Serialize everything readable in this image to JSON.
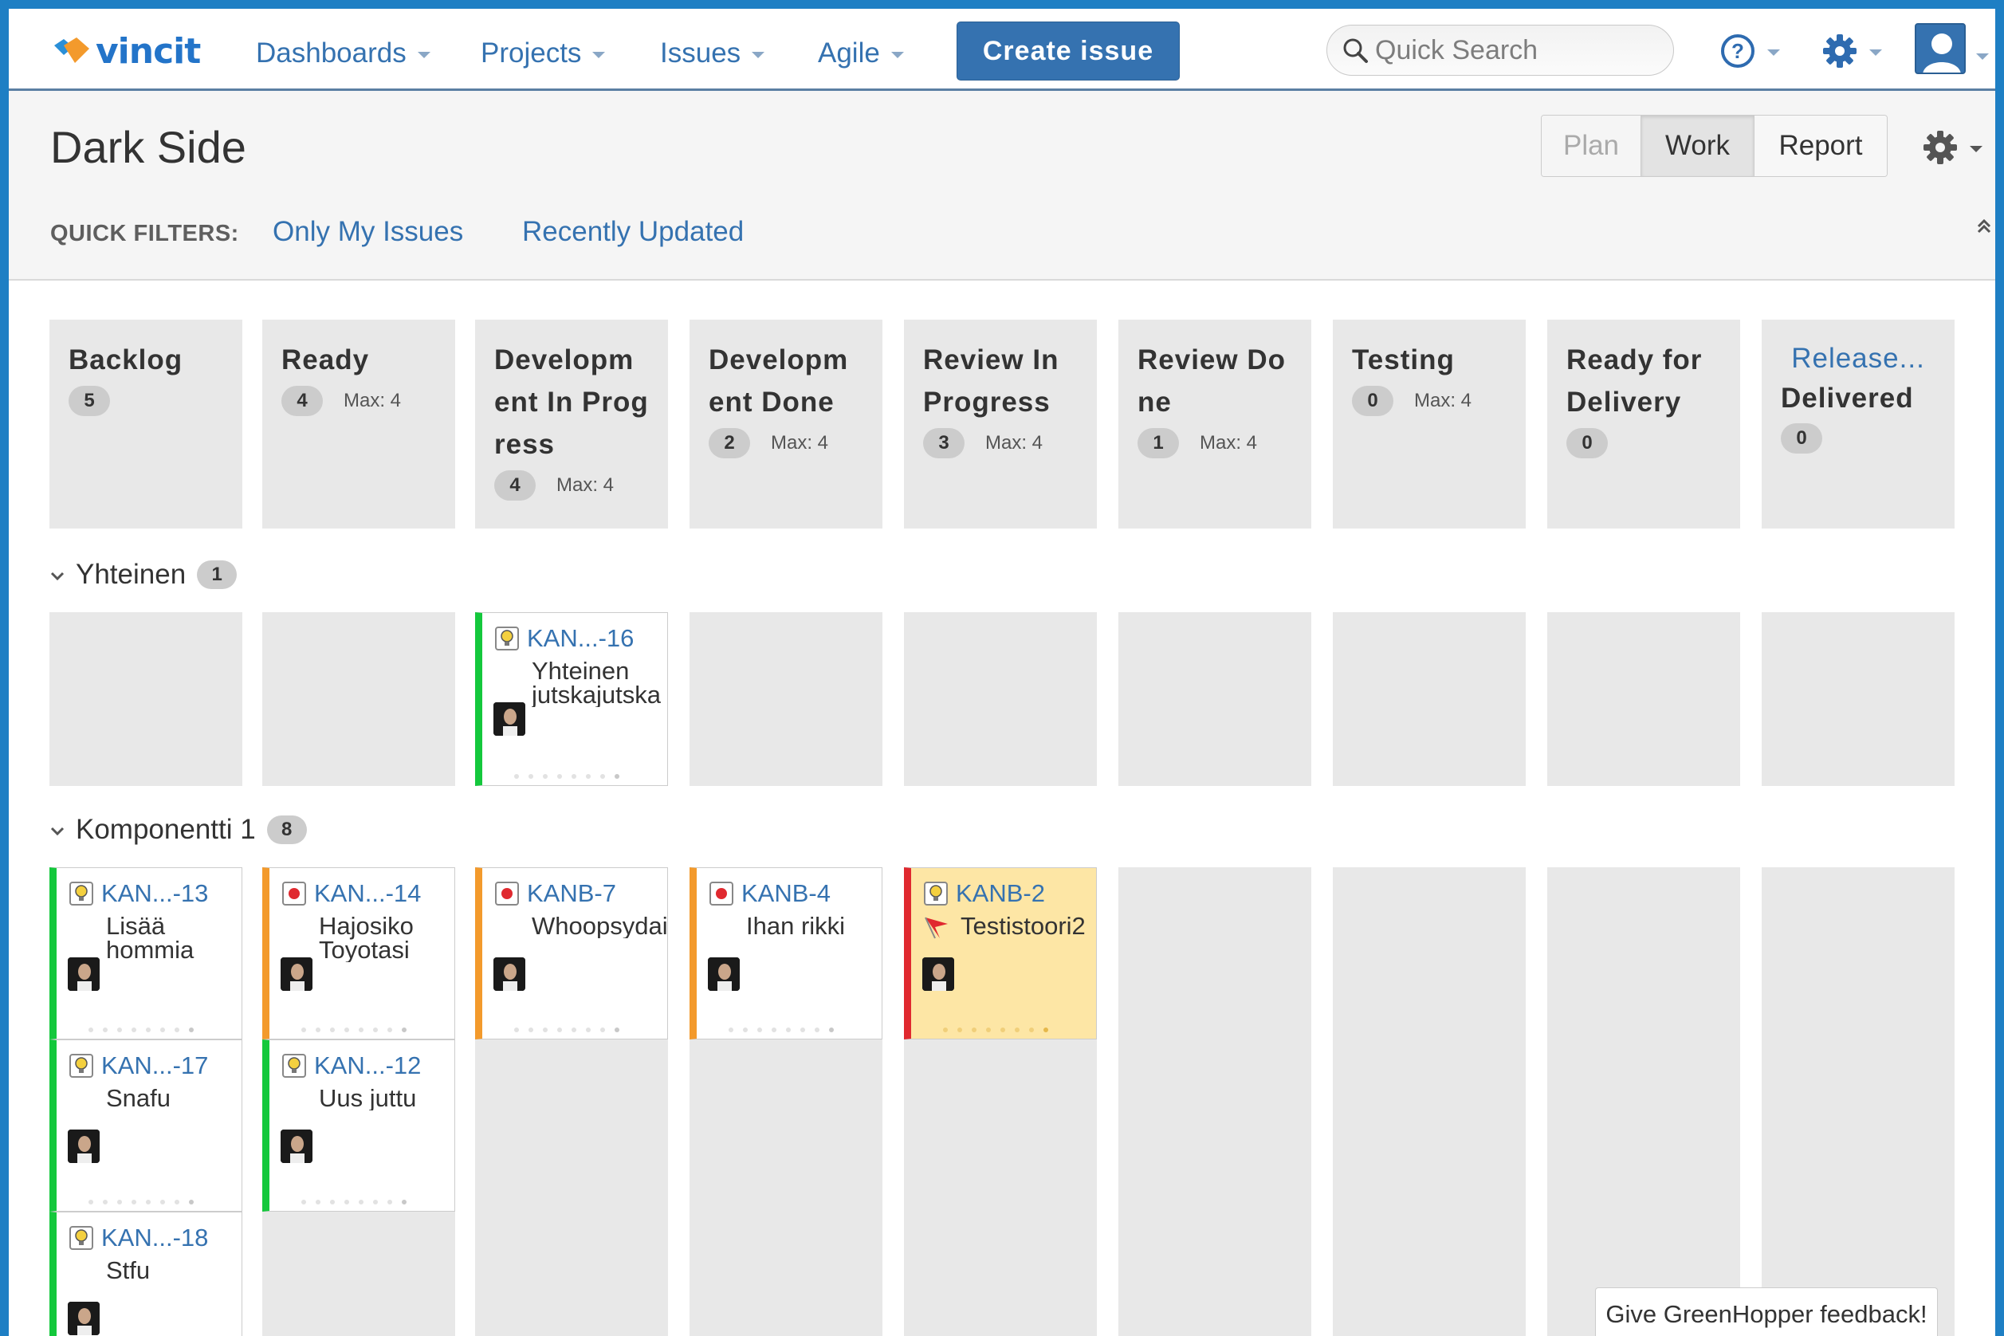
{
  "header": {
    "logo_text": "vincit",
    "nav": [
      {
        "label": "Dashboards"
      },
      {
        "label": "Projects"
      },
      {
        "label": "Issues"
      },
      {
        "label": "Agile"
      }
    ],
    "create_label": "Create issue",
    "search_placeholder": "Quick Search"
  },
  "board": {
    "title": "Dark Side",
    "modes": [
      {
        "label": "Plan",
        "state": "disabled"
      },
      {
        "label": "Work",
        "state": "active"
      },
      {
        "label": "Report",
        "state": "normal"
      }
    ],
    "quick_filters_label": "QUICK FILTERS:",
    "quick_filters": [
      "Only My Issues",
      "Recently Updated"
    ]
  },
  "columns": [
    {
      "name": "Backlog",
      "count": "5",
      "max": ""
    },
    {
      "name": "Ready",
      "count": "4",
      "max": "Max: 4"
    },
    {
      "name": "Development In Progress",
      "count": "4",
      "max": "Max: 4"
    },
    {
      "name": "Development Done",
      "count": "2",
      "max": "Max: 4"
    },
    {
      "name": "Review In Progress",
      "count": "3",
      "max": "Max: 4"
    },
    {
      "name": "Review Done",
      "count": "1",
      "max": "Max: 4"
    },
    {
      "name": "Testing",
      "count": "0",
      "max": "Max: 4"
    },
    {
      "name": "Ready for Delivery",
      "count": "0",
      "max": ""
    },
    {
      "name": "Delivered",
      "link": "Release...",
      "count": "0",
      "max": ""
    }
  ],
  "swimlanes": [
    {
      "name": "Yhteinen",
      "count": "1"
    },
    {
      "name": "Komponentti 1",
      "count": "8"
    }
  ],
  "cards": [
    {
      "key": "KAN...-16",
      "summary": "Yhteinen jutskajutska",
      "type": "improvement",
      "color": "green"
    },
    {
      "key": "KAN...-13",
      "summary": "Lisää hommia",
      "type": "improvement",
      "color": "green"
    },
    {
      "key": "KAN...-17",
      "summary": "Snafu",
      "type": "improvement",
      "color": "green"
    },
    {
      "key": "KAN...-18",
      "summary": "Stfu",
      "type": "improvement",
      "color": "green"
    },
    {
      "key": "KAN...-14",
      "summary": "Hajosiko Toyotasi",
      "type": "bug",
      "color": "orange"
    },
    {
      "key": "KAN...-12",
      "summary": "Uus juttu",
      "type": "improvement",
      "color": "green"
    },
    {
      "key": "KANB-7",
      "summary": "Whoopsydaisy",
      "type": "bug",
      "color": "orange"
    },
    {
      "key": "KANB-4",
      "summary": "Ihan rikki",
      "type": "bug",
      "color": "orange"
    },
    {
      "key": "KANB-2",
      "summary": "Testistoori2",
      "type": "improvement",
      "color": "red",
      "flagged": true
    }
  ],
  "feedback_label": "Give GreenHopper feedback!",
  "colors": {
    "accent": "#3572b0",
    "frame": "#1e7fc4",
    "green": "#14c83c",
    "orange": "#f39a2c",
    "red": "#e0292f",
    "flag_bg": "#fde6a5"
  }
}
